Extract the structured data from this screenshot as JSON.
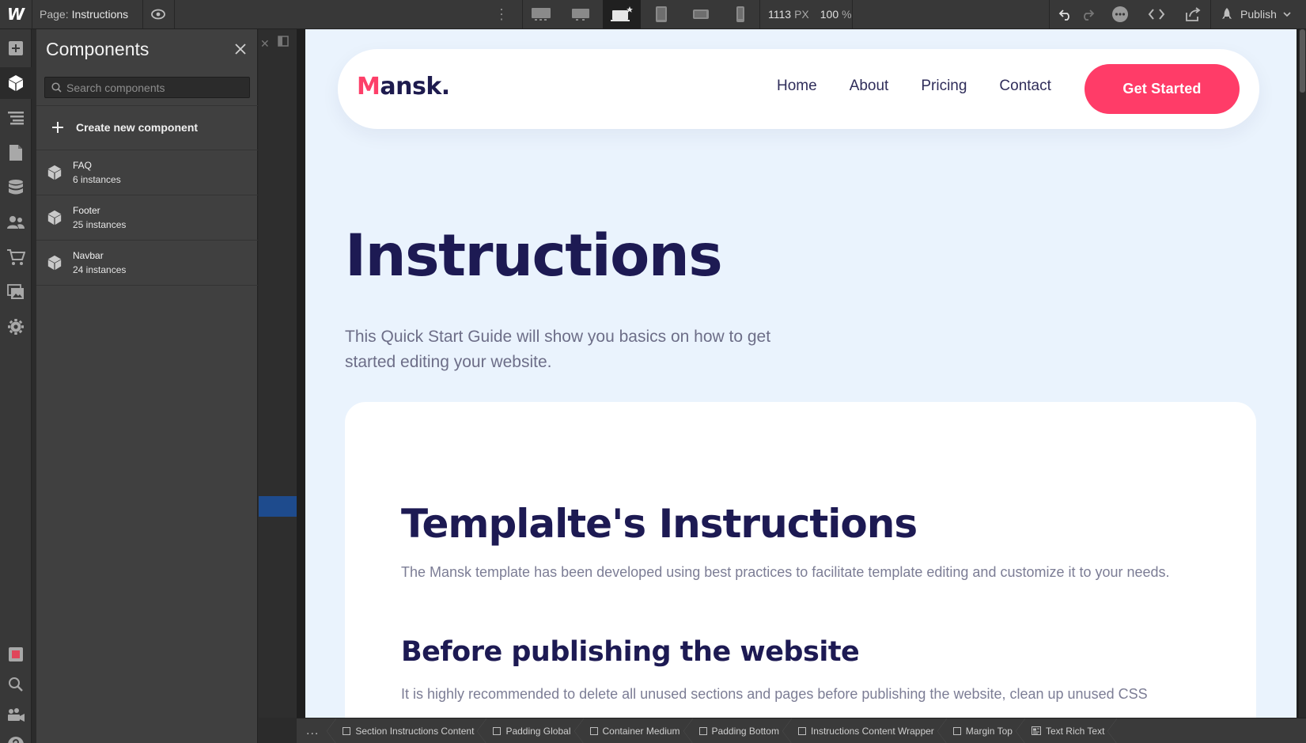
{
  "app": {
    "logo": "W"
  },
  "topbar": {
    "page_prefix": "Page:",
    "page_name": "Instructions",
    "width_value": "1113",
    "width_unit": "PX",
    "zoom_value": "100",
    "zoom_unit": "%",
    "publish_label": "Publish",
    "active_breakpoint": "laptop-base"
  },
  "components_panel": {
    "title": "Components",
    "search_placeholder": "Search components",
    "create_label": "Create new component",
    "items": [
      {
        "name": "FAQ",
        "count": "6 instances"
      },
      {
        "name": "Footer",
        "count": "25 instances"
      },
      {
        "name": "Navbar",
        "count": "24 instances"
      }
    ]
  },
  "site": {
    "brand_initial": "M",
    "brand_rest": "ansk.",
    "nav": [
      "Home",
      "About",
      "Pricing",
      "Contact"
    ],
    "cta": "Get Started",
    "hero_title": "Instructions",
    "hero_lead": "This Quick Start Guide will show you basics on how to get started editing your website.",
    "card_title": "Templalte's Instructions",
    "card_text": "The Mansk template has been developed using best practices to facilitate template editing and customize it to your needs.",
    "section_title": "Before publishing the website",
    "section_text": "It is highly recommended to delete all unused sections and pages before publishing the website, clean up unused CSS"
  },
  "breadcrumbs": {
    "more": "...",
    "items": [
      "Section Instructions Content",
      "Padding Global",
      "Container Medium",
      "Padding Bottom",
      "Instructions Content Wrapper",
      "Margin Top",
      "Text Rich Text"
    ]
  },
  "colors": {
    "brand_accent": "#ff3c68",
    "heading": "#1d1a53",
    "canvas_bg": "#eaf3fd",
    "selection_blue": "#1e4b8d"
  }
}
